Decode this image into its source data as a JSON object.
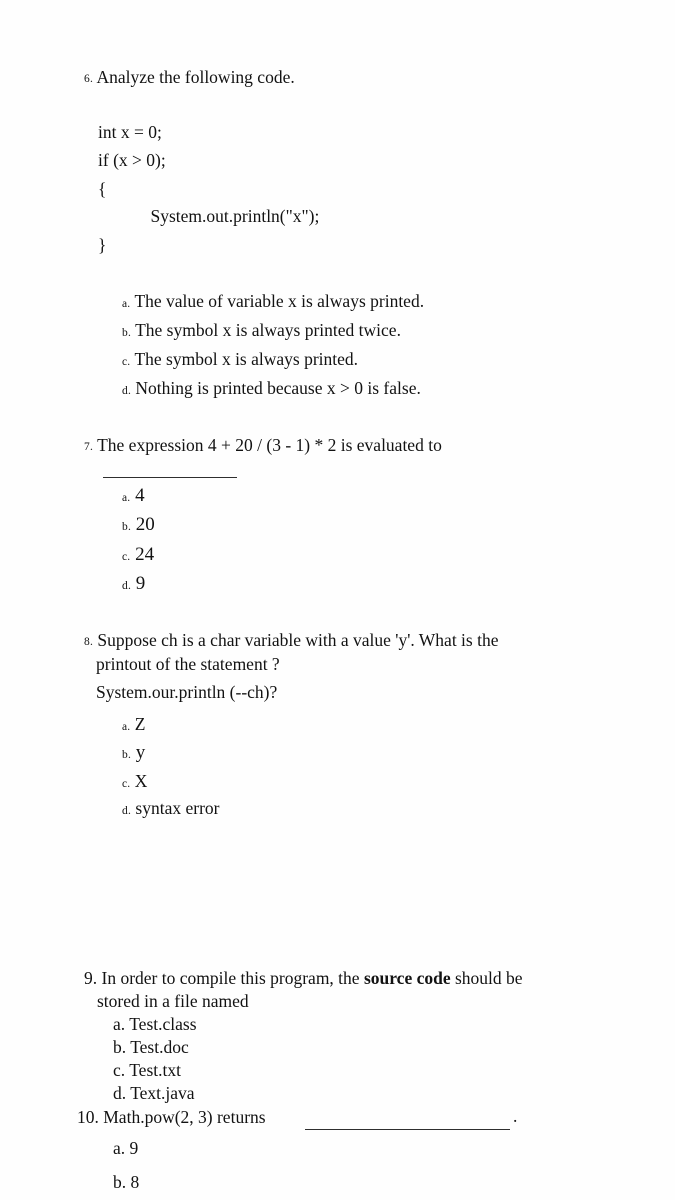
{
  "document": {
    "type": "exam-worksheet",
    "subject": "Java programming multiple choice questions",
    "background_color": "#fefefe",
    "text_color": "#121212"
  },
  "questions": [
    {
      "number": "6.",
      "prompt": "Analyze the following code.",
      "code_lines": [
        "int x = 0;",
        "if (x > 0);",
        "{",
        "            System.out.println(\"x\");",
        "}"
      ],
      "options": [
        {
          "letter": "a.",
          "text": "The value of variable x is always printed."
        },
        {
          "letter": "b.",
          "text": "The symbol x is always printed twice."
        },
        {
          "letter": "c.",
          "text": "The symbol x is always printed."
        },
        {
          "letter": "d.",
          "text": "Nothing is printed because x > 0 is false."
        }
      ]
    },
    {
      "number": "7.",
      "prompt": "The expression 4 + 20 / (3 - 1) * 2 is evaluated to",
      "has_blank": true,
      "options": [
        {
          "letter": "a.",
          "text": "4"
        },
        {
          "letter": "b.",
          "text": "20"
        },
        {
          "letter": "c.",
          "text": "24"
        },
        {
          "letter": "d.",
          "text": "9"
        }
      ]
    },
    {
      "number": "8.",
      "prompt_line_1": "Suppose ch is a char variable with a value 'y'. What is the",
      "prompt_line_2": "printout of the statement ?",
      "prompt_line_3": "System.our.println (--ch)?",
      "options": [
        {
          "letter": "a.",
          "text": "Z"
        },
        {
          "letter": "b.",
          "text": "y"
        },
        {
          "letter": "c.",
          "text": "X"
        },
        {
          "letter": "d.",
          "text": "syntax error"
        }
      ]
    },
    {
      "number": "9.",
      "prompt_line_1_before_bold": "In order to compile this program, the ",
      "prompt_line_1_bold": "source code",
      "prompt_line_1_after_bold": " should be",
      "prompt_line_2": "stored in a file named",
      "options": [
        {
          "letter": "a.",
          "text": "Test.class"
        },
        {
          "letter": "b.",
          "text": "Test.doc"
        },
        {
          "letter": "c.",
          "text": "Test.txt"
        },
        {
          "letter": "d.",
          "text": "Text.java"
        }
      ]
    },
    {
      "number": "10.",
      "prompt": "Math.pow(2, 3) returns",
      "has_blank": true,
      "trailing_period": ".",
      "options": [
        {
          "letter": "a.",
          "text": "9"
        },
        {
          "letter": "b.",
          "text": "8"
        }
      ]
    }
  ]
}
